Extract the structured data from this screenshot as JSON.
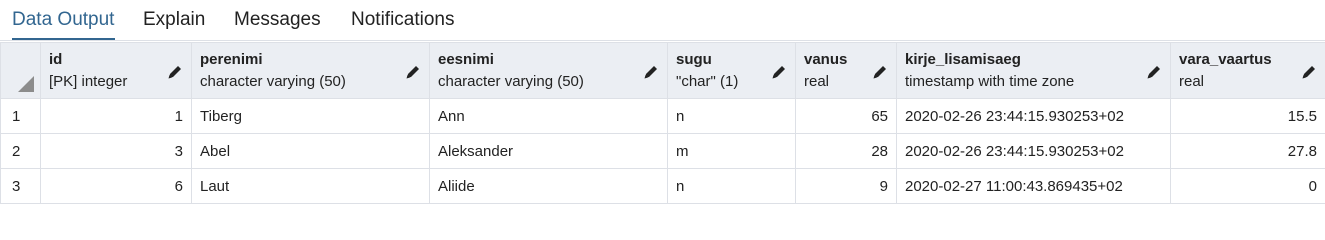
{
  "tabs": [
    {
      "label": "Data Output",
      "active": true
    },
    {
      "label": "Explain",
      "active": false
    },
    {
      "label": "Messages",
      "active": false
    },
    {
      "label": "Notifications",
      "active": false
    }
  ],
  "columns": [
    {
      "name": "id",
      "type": "[PK] integer"
    },
    {
      "name": "perenimi",
      "type": "character varying (50)"
    },
    {
      "name": "eesnimi",
      "type": "character varying (50)"
    },
    {
      "name": "sugu",
      "type": "\"char\" (1)"
    },
    {
      "name": "vanus",
      "type": "real"
    },
    {
      "name": "kirje_lisamisaeg",
      "type": "timestamp with time zone"
    },
    {
      "name": "vara_vaartus",
      "type": "real"
    }
  ],
  "rows": [
    {
      "rownum": "1",
      "cells": [
        "1",
        "Tiberg",
        "Ann",
        "n",
        "65",
        "2020-02-26 23:44:15.930253+02",
        "15.5"
      ]
    },
    {
      "rownum": "2",
      "cells": [
        "3",
        "Abel",
        "Aleksander",
        "m",
        "28",
        "2020-02-26 23:44:15.930253+02",
        "27.8"
      ]
    },
    {
      "rownum": "3",
      "cells": [
        "6",
        "Laut",
        "Aliide",
        "n",
        "9",
        "2020-02-27 11:00:43.869435+02",
        "0"
      ]
    }
  ],
  "colors": {
    "accent": "#326690",
    "header_bg": "#ebeef3",
    "grid_line": "#dde0e6"
  },
  "icons": {
    "column_edit": "pencil-icon",
    "corner": "select-all-triangle"
  }
}
